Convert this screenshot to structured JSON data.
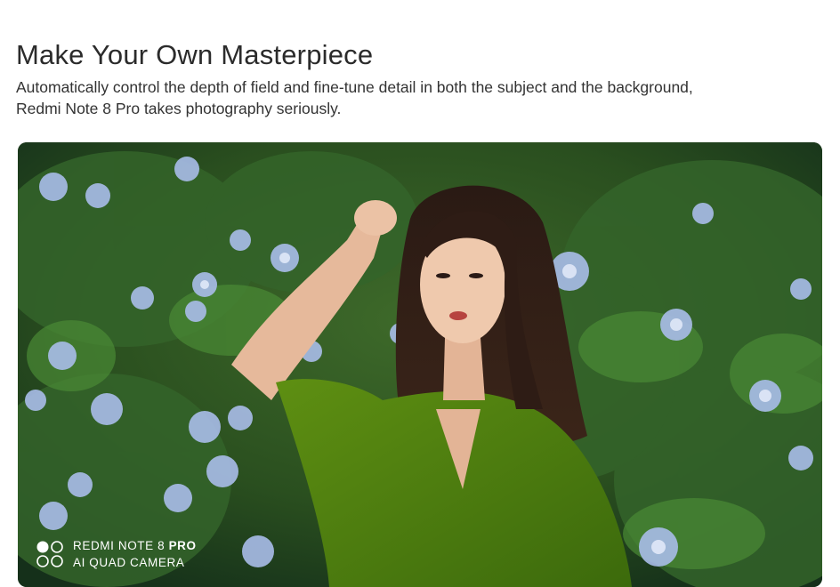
{
  "header": {
    "title": "Make Your Own Masterpiece",
    "description_line1": "Automatically control the depth of field and fine-tune detail in both the subject and the background,",
    "description_line2": "Redmi Note 8 Pro takes photography seriously."
  },
  "photo": {
    "subject": "woman-in-green-shirt-among-blue-flowers",
    "watermark": {
      "icon": "quad-camera-icon",
      "line1_prefix": "REDMI NOTE 8 ",
      "line1_bold": "PRO",
      "line2": "AI QUAD CAMERA"
    }
  },
  "colors": {
    "foliage": "#2f5a22",
    "flowers": "#9fb3e6",
    "shirt": "#4e7d0f",
    "text": "#333333"
  }
}
